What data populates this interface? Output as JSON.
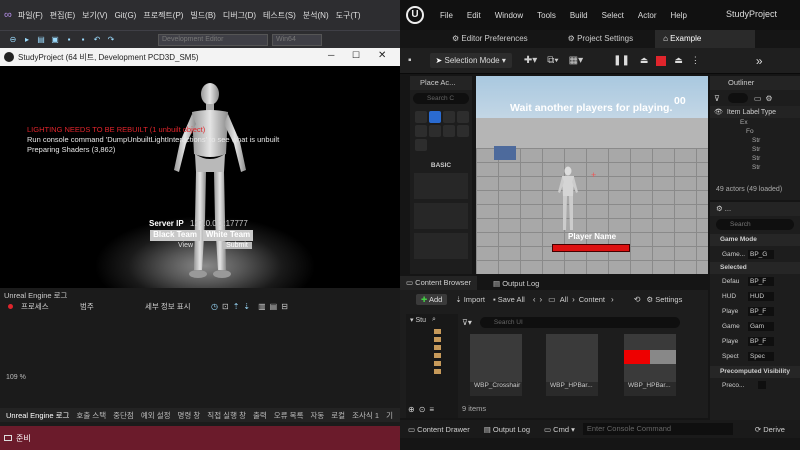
{
  "vs": {
    "menu": [
      "파일(F)",
      "편집(E)",
      "보기(V)",
      "Git(G)",
      "프로젝트(P)",
      "빌드(B)",
      "디버그(D)",
      "테스트(S)",
      "분석(N)",
      "도구(T)"
    ],
    "toolbar": {
      "config_field": "Development Editor",
      "platform_field": "Win64"
    },
    "game_window": {
      "title": "StudyProject (64 비트, Development PCD3D_SM5)",
      "warning": "LIGHTING NEEDS TO BE REBUILT (1 unbuilt object)",
      "console_line": "Run console command 'DumpUnbuiltLightInteractions' to see what is unbuilt",
      "shaders_line": "Preparing Shaders (3,862)",
      "server_ip_label": "Server IP",
      "server_ip_value": "127.0.0.1:17777",
      "black_team": "Black Team",
      "white_team": "White Team",
      "view_label": "View",
      "submit_label": "Submit"
    },
    "output": {
      "title": "Unreal Engine 로그",
      "process_label": "프로세스",
      "scope_label": "범주",
      "detail_label": "세부 정보 표시",
      "zoom": "109 %"
    },
    "bottom_tabs": [
      "Unreal Engine 로그",
      "호출 스택",
      "중단점",
      "예외 설정",
      "명령 창",
      "직접 실행 창",
      "출력",
      "오류 목록",
      "자동",
      "로컬",
      "조사식 1",
      "기"
    ],
    "status": "준비"
  },
  "ue": {
    "menu": [
      "File",
      "Edit",
      "Window",
      "Tools",
      "Build",
      "Select",
      "Actor",
      "Help"
    ],
    "project_name": "StudyProject",
    "tabs": [
      "Editor Preferences",
      "Project Settings",
      "Example"
    ],
    "toolbar": {
      "selection_mode": "Selection Mode"
    },
    "place_actors": {
      "title": "Place Ac...",
      "search_placeholder": "Search C",
      "basic_label": "BASIC"
    },
    "viewport": {
      "wait_text": "Wait another players for playing.",
      "counter": "00",
      "player_name": "Player Name"
    },
    "outliner": {
      "title": "Outliner",
      "col_label": "Item Label",
      "col_type": "Type",
      "rows": [
        "Ex",
        "Fo",
        "Str",
        "Str",
        "Str",
        "Str"
      ],
      "actors_count": "49 actors (49 loaded)"
    },
    "details": {
      "search_placeholder": "Search",
      "game_mode_section": "Game Mode",
      "game_mode_label": "Game...",
      "game_mode_value": "BP_G",
      "selected_section": "Selected",
      "rows": [
        {
          "label": "Defau",
          "value": "BP_F"
        },
        {
          "label": "HUD",
          "value": "HUD"
        },
        {
          "label": "Playe",
          "value": "BP_F"
        },
        {
          "label": "Game",
          "value": "Gam"
        },
        {
          "label": "Playe",
          "value": "BP_F"
        },
        {
          "label": "Spect",
          "value": "Spec"
        }
      ],
      "precomputed_section": "Precomputed Visibility",
      "preco_label": "Preco..."
    },
    "content_browser": {
      "tab": "Content Browser",
      "output_log_tab": "Output Log",
      "add_label": "Add",
      "import_label": "Import",
      "save_all_label": "Save All",
      "path_all": "All",
      "path_content": "Content",
      "settings_label": "Settings",
      "tree_label": "Stu",
      "search_placeholder": "Search UI",
      "assets": [
        "WBP_Crosshair",
        "WBP_HPBar...",
        "WBP_HPBar..."
      ],
      "items_count": "9 items"
    },
    "status": {
      "content_drawer": "Content Drawer",
      "output_log": "Output Log",
      "cmd": "Cmd",
      "console_placeholder": "Enter Console Command",
      "derive": "Derive"
    }
  }
}
